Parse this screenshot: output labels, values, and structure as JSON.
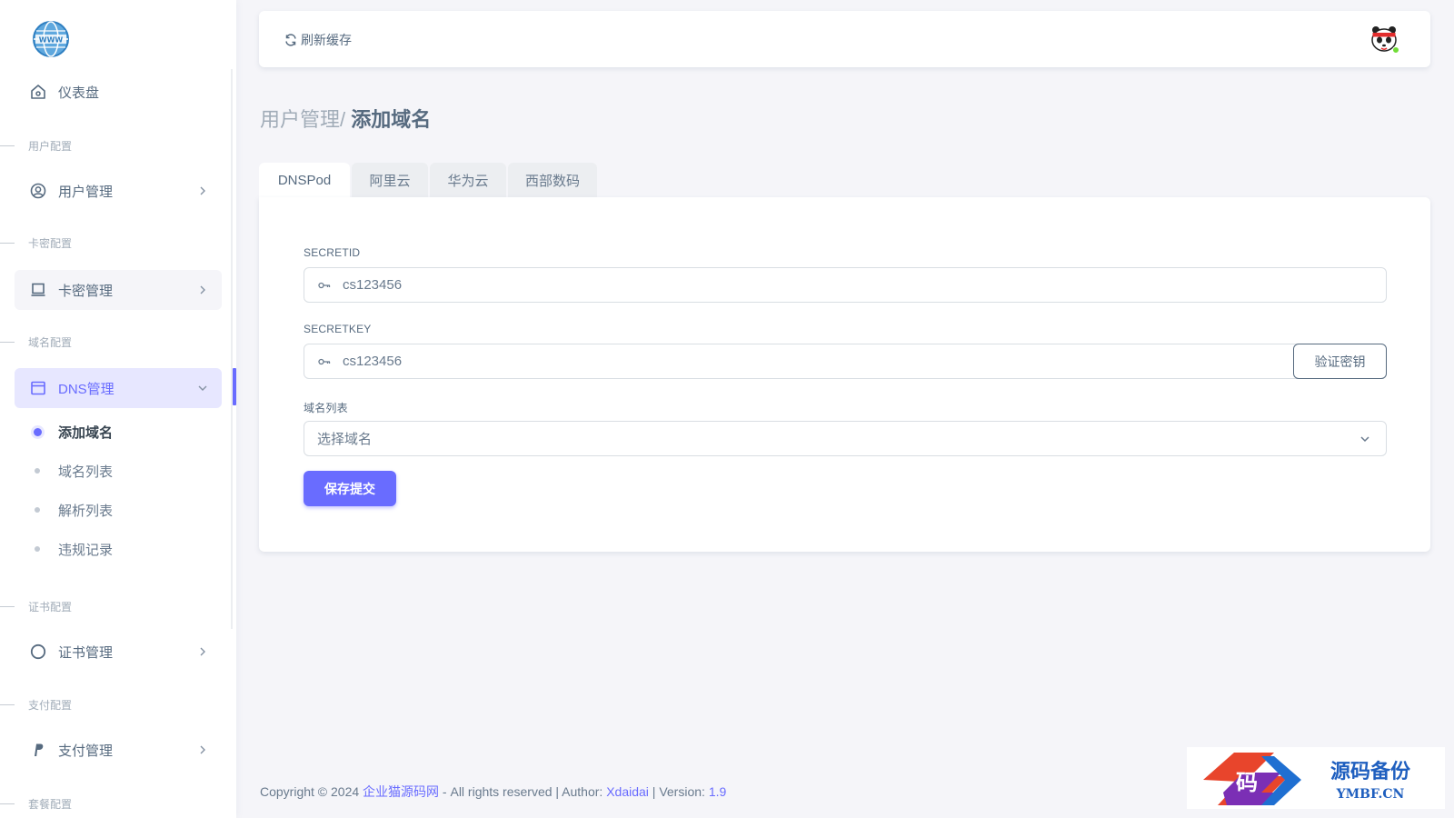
{
  "sidebar": {
    "dashboard": {
      "label": "仪表盘",
      "icon": "home-icon"
    },
    "sections": [
      {
        "header": "用户配置"
      },
      {
        "header": "卡密配置"
      },
      {
        "header": "域名配置"
      },
      {
        "header": "证书配置"
      },
      {
        "header": "支付配置"
      },
      {
        "header": "套餐配置"
      }
    ],
    "menus": {
      "user_mgmt": {
        "label": "用户管理",
        "icon": "user-circle-icon"
      },
      "card_mgmt": {
        "label": "卡密管理",
        "icon": "laptop-icon"
      },
      "dns_mgmt": {
        "label": "DNS管理",
        "icon": "window-icon"
      },
      "cert_mgmt": {
        "label": "证书管理",
        "icon": "circle-icon"
      },
      "pay_mgmt": {
        "label": "支付管理",
        "icon": "paypal-icon"
      }
    },
    "dns_sub": [
      {
        "label": "添加域名",
        "active": true
      },
      {
        "label": "域名列表",
        "active": false
      },
      {
        "label": "解析列表",
        "active": false
      },
      {
        "label": "违规记录",
        "active": false
      }
    ]
  },
  "navbar": {
    "refresh_label": "刷新缓存",
    "refresh_icon": "refresh-icon"
  },
  "breadcrumb": {
    "parent": "用户管理/",
    "current": "添加域名"
  },
  "tabs": [
    {
      "label": "DNSPod",
      "active": true
    },
    {
      "label": "阿里云",
      "active": false
    },
    {
      "label": "华为云",
      "active": false
    },
    {
      "label": "西部数码",
      "active": false
    }
  ],
  "form": {
    "secret_id": {
      "label": "SECRETID",
      "value": "cs123456"
    },
    "secret_key": {
      "label": "SECRETKEY",
      "value": "cs123456"
    },
    "verify_label": "验证密钥",
    "domain": {
      "label": "域名列表",
      "selected": "选择域名"
    },
    "submit_label": "保存提交"
  },
  "footer": {
    "copyright": "Copyright © 2024 ",
    "site_name": "企业猫源码网",
    "rights": " - All rights reserved | Author: ",
    "author": "Xdaidai",
    "version_prefix": " | Version: ",
    "version": "1.9"
  },
  "watermark": {
    "glyph": "码",
    "title": "源码备份",
    "domain": "YMBF.CN"
  },
  "colors": {
    "primary": "#696cff",
    "primary_light": "#e7e7ff",
    "text": "#697a8d",
    "heading": "#566a7f",
    "background": "#f5f5f9",
    "online": "#71dd37"
  }
}
